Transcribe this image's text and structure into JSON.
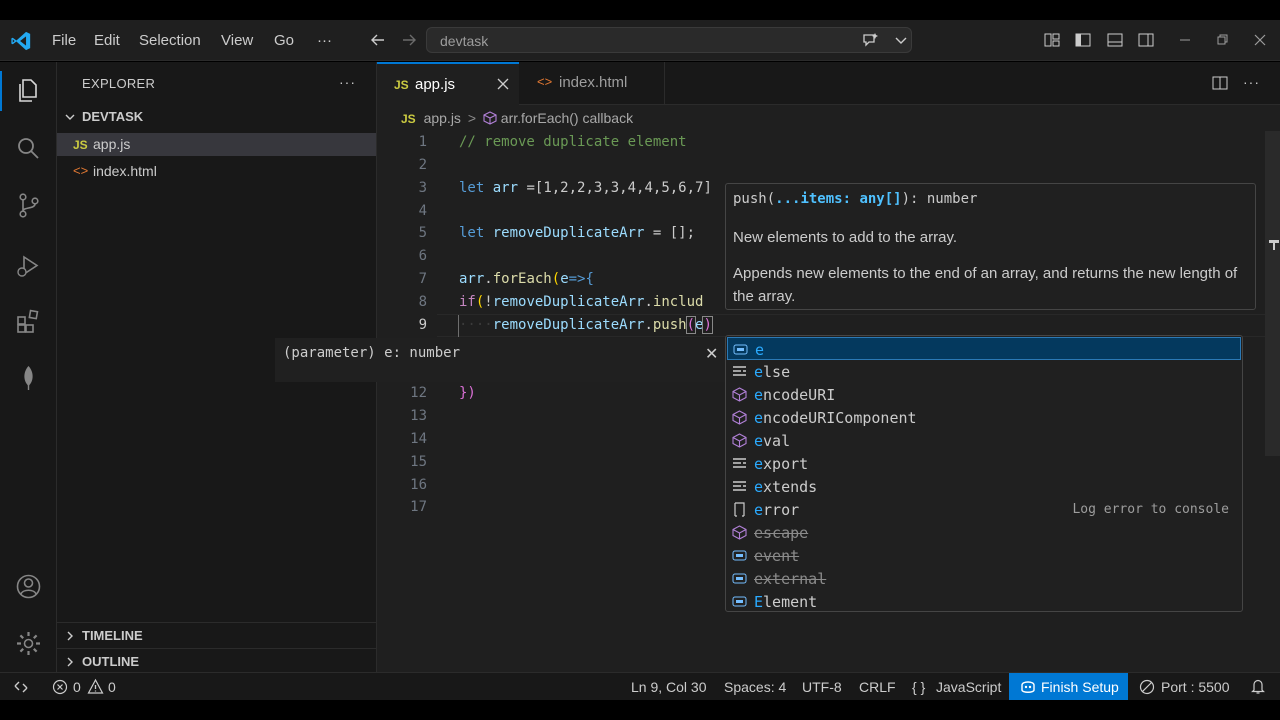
{
  "titlebar": {
    "menus": [
      "File",
      "Edit",
      "Selection",
      "View",
      "Go"
    ],
    "more": "···",
    "search_text": "devtask"
  },
  "sidebar": {
    "title": "EXPLORER",
    "more": "···",
    "folder": "DEVTASK",
    "files": [
      {
        "badge": "JS",
        "name": "app.js"
      },
      {
        "badge": "<>",
        "name": "index.html"
      }
    ],
    "sections": [
      "TIMELINE",
      "OUTLINE"
    ]
  },
  "tabs": [
    {
      "badge": "JS",
      "label": "app.js"
    },
    {
      "badge": "<>",
      "label": "index.html"
    }
  ],
  "breadcrumb": {
    "badge": "JS",
    "file": "app.js",
    "separator": ">",
    "symbol": "arr.forEach() callback"
  },
  "editor": {
    "line_numbers": [
      "1",
      "2",
      "3",
      "4",
      "5",
      "6",
      "7",
      "8",
      "9",
      "12",
      "13",
      "14",
      "15",
      "16",
      "17"
    ],
    "code": {
      "l1": "// remove duplicate element",
      "l3_kw": "let",
      "l3_var": "arr",
      "l3_rest": " =[1,2,2,3,3,4,4,5,6,7]",
      "l5_kw": "let",
      "l5_var": "removeDuplicateArr",
      "l5_rest": " = [];",
      "l7_var": "arr",
      "l7_fn": "forEach",
      "l7_param": "e",
      "l7_rest": "=>{",
      "l8_kw": "if",
      "l8_var": "removeDuplicateArr",
      "l8_fn": "includ",
      "l9_var": "removeDuplicateArr",
      "l9_fn": "push",
      "l9_arg": "e",
      "l12": "})"
    }
  },
  "hover": {
    "signature_prefix": "push(",
    "signature_param": "...items: any[]",
    "signature_suffix": "): number",
    "param_doc": "New elements to add to the array.",
    "description": "Appends new elements to the end of an array, and returns the new length of the array."
  },
  "param_hint": {
    "text": "(parameter) e: number",
    "close": "✕"
  },
  "suggestions": [
    {
      "label": "e",
      "kind": "variable",
      "focused": true
    },
    {
      "label": "else",
      "kind": "keyword"
    },
    {
      "label": "encodeURI",
      "kind": "function"
    },
    {
      "label": "encodeURIComponent",
      "kind": "function"
    },
    {
      "label": "eval",
      "kind": "function"
    },
    {
      "label": "export",
      "kind": "keyword"
    },
    {
      "label": "extends",
      "kind": "keyword"
    },
    {
      "label": "error",
      "kind": "snippet",
      "detail": "Log error to console"
    },
    {
      "label": "escape",
      "kind": "function",
      "deprecated": true
    },
    {
      "label": "event",
      "kind": "variable",
      "deprecated": true
    },
    {
      "label": "external",
      "kind": "variable",
      "deprecated": true
    },
    {
      "label": "Element",
      "kind": "variable"
    }
  ],
  "statusbar": {
    "errors": "0",
    "warnings": "0",
    "position": "Ln 9, Col 30",
    "spaces": "Spaces: 4",
    "encoding": "UTF-8",
    "eol": "CRLF",
    "language_braces": "{ }",
    "language": "JavaScript",
    "finish_setup": "Finish Setup",
    "port": "Port : 5500"
  },
  "colors": {
    "accent": "#0078d4",
    "js_badge": "#cbcb41",
    "html_badge": "#e37933",
    "match": "#2aaaff"
  }
}
